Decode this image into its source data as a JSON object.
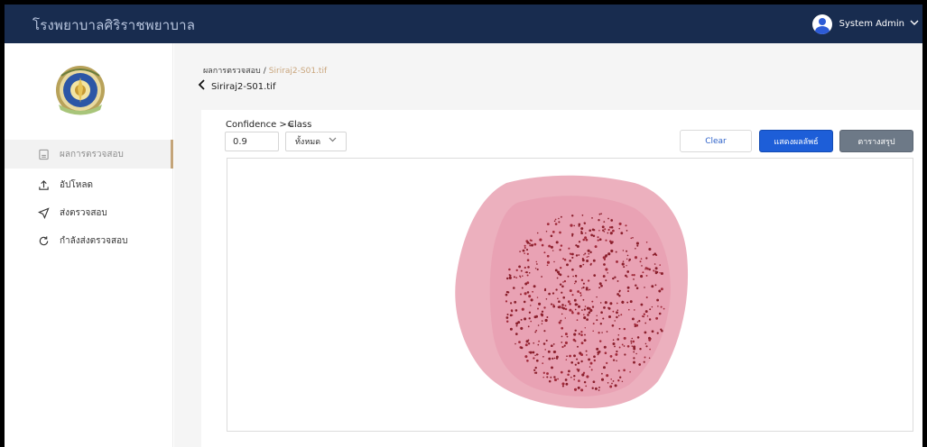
{
  "header": {
    "app_title": "โรงพยาบาลศิริราชพยาบาล",
    "user_name": "System Admin",
    "user_icon": "user-avatar-icon",
    "dropdown_icon": "chevron-down-icon",
    "bg_color": "#182c4f"
  },
  "sidebar": {
    "logo": "hospital-seal-logo",
    "items": [
      {
        "label": "ผลการตรวจสอบ",
        "icon": "document-icon",
        "active": true
      },
      {
        "label": "อัปโหลด",
        "icon": "upload-icon",
        "active": false
      },
      {
        "label": "ส่งตรวจสอบ",
        "icon": "send-icon",
        "active": false
      },
      {
        "label": "กำลังส่งตรวจสอบ",
        "icon": "refresh-icon",
        "active": false
      }
    ],
    "active_accent": "#c4a57a"
  },
  "breadcrumb": {
    "parent": "ผลการตรวจสอบ",
    "separator": "/",
    "current": "Siriraj2-S01.tif"
  },
  "page": {
    "title": "Siriraj2-S01.tif",
    "back_icon": "chevron-left-icon"
  },
  "filters": {
    "confidence_label": "Confidence >=",
    "confidence_value": "0.9",
    "class_label": "Class",
    "class_value": "ทั้งหมด"
  },
  "actions": {
    "clear_label": "Clear",
    "show_label": "แสดงผลลัพธ์",
    "table_label": "ตารางสรุป",
    "primary_color": "#1d5ed8",
    "secondary_color": "#6d7987"
  },
  "viewer": {
    "image": "stained-tissue-slide"
  }
}
